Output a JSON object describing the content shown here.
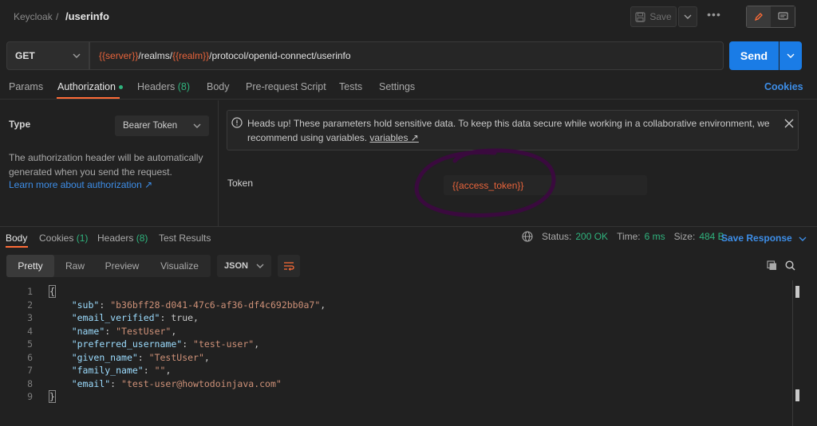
{
  "breadcrumb": {
    "parent": "Keycloak",
    "separator": "/",
    "current": "/userinfo"
  },
  "toolbar": {
    "save_label": "Save",
    "more_label": "•••"
  },
  "request": {
    "method": "GET",
    "url_parts": [
      "{{server}}",
      "/realms/",
      "{{realm}}",
      "/protocol/openid-connect/userinfo"
    ],
    "send_label": "Send"
  },
  "request_tabs": [
    {
      "label": "Params"
    },
    {
      "label": "Authorization"
    },
    {
      "label": "Headers",
      "count": "(8)"
    },
    {
      "label": "Body"
    },
    {
      "label": "Pre-request Script"
    },
    {
      "label": "Tests"
    },
    {
      "label": "Settings"
    }
  ],
  "cookies_label": "Cookies",
  "auth": {
    "type_label": "Type",
    "type_value": "Bearer Token",
    "help_text": "The authorization header will be automatically generated when you send the request.",
    "learn_link": "Learn more about authorization ↗",
    "warning_text": "Heads up! These parameters hold sensitive data. To keep this data secure while working in a collaborative environment, we recommend using variables.",
    "warning_link": "variables ↗",
    "token_label": "Token",
    "token_value": "{{access_token}}"
  },
  "response_tabs": [
    {
      "label": "Body"
    },
    {
      "label": "Cookies",
      "count": "(1)"
    },
    {
      "label": "Headers",
      "count": "(8)"
    },
    {
      "label": "Test Results"
    }
  ],
  "response_status": {
    "status_label": "Status:",
    "status_value": "200 OK",
    "time_label": "Time:",
    "time_value": "6 ms",
    "size_label": "Size:",
    "size_value": "484 B",
    "save_response_label": "Save Response"
  },
  "format_tabs": [
    "Pretty",
    "Raw",
    "Preview",
    "Visualize"
  ],
  "format_select": "JSON",
  "response_body": [
    {
      "line": "1",
      "open": "{"
    },
    {
      "line": "2",
      "key": "\"sub\"",
      "value": "\"b36bff28-d041-47c6-af36-df4c692bb0a7\"",
      "trail": ","
    },
    {
      "line": "3",
      "key": "\"email_verified\"",
      "value": "true",
      "trail": ",",
      "plain": true
    },
    {
      "line": "4",
      "key": "\"name\"",
      "value": "\"TestUser\"",
      "trail": ","
    },
    {
      "line": "5",
      "key": "\"preferred_username\"",
      "value": "\"test-user\"",
      "trail": ","
    },
    {
      "line": "6",
      "key": "\"given_name\"",
      "value": "\"TestUser\"",
      "trail": ","
    },
    {
      "line": "7",
      "key": "\"family_name\"",
      "value": "\"\"",
      "trail": ","
    },
    {
      "line": "8",
      "key": "\"email\"",
      "value": "\"test-user@howtodoinjava.com\"",
      "trail": ""
    },
    {
      "line": "9",
      "open": "}"
    }
  ],
  "colors": {
    "accent": "#ff6c37",
    "primary": "#1a7ce6",
    "success": "#2fb37d",
    "variable": "#e8643b"
  }
}
